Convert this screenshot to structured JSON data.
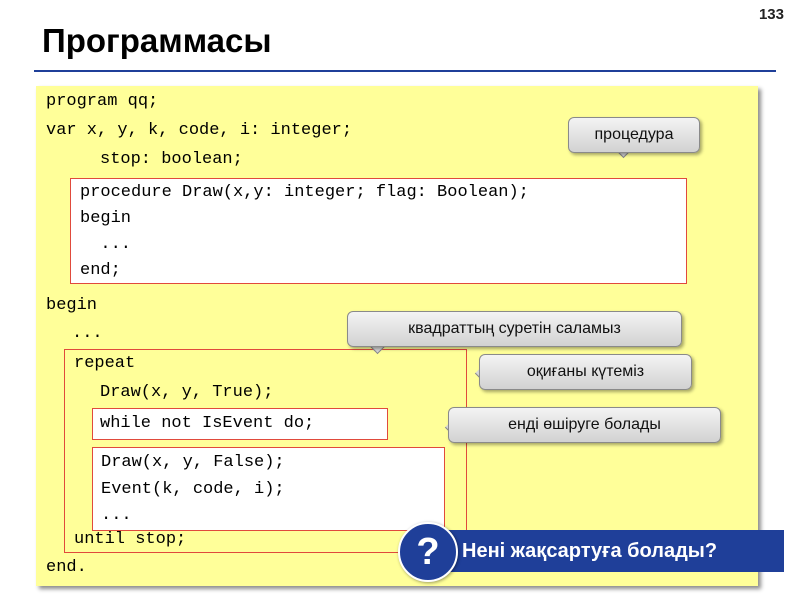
{
  "page_number": "133",
  "title": "Программасы",
  "code": {
    "program": "program qq;",
    "var_line": "var x, y, k, code, i: integer;",
    "stop_line": "stop: boolean;",
    "procedure_block": [
      "procedure Draw(x,y: integer; flag: Boolean);",
      "begin",
      "  ...",
      "end;"
    ],
    "begin": "begin",
    "dots": "...",
    "repeat": "repeat",
    "draw_true": "Draw(x, y, True);",
    "while_line": "while not IsEvent do;",
    "inner_block": [
      "Draw(x, y, False);",
      "Event(k, code, i);",
      "..."
    ],
    "until": "until stop;",
    "end": "end."
  },
  "callouts": {
    "procedure": "процедура",
    "draw_square": "квадраттың суретін саламыз",
    "wait_event": "оқиғаны күтеміз",
    "can_erase": "енді өшіруге болады"
  },
  "question": {
    "icon": "question-mark-icon",
    "text": "Нені жақсартуға болады?"
  },
  "colors": {
    "panel": "#ffff99",
    "box_border": "#e04a3c",
    "accent_blue": "#1f3f99"
  }
}
